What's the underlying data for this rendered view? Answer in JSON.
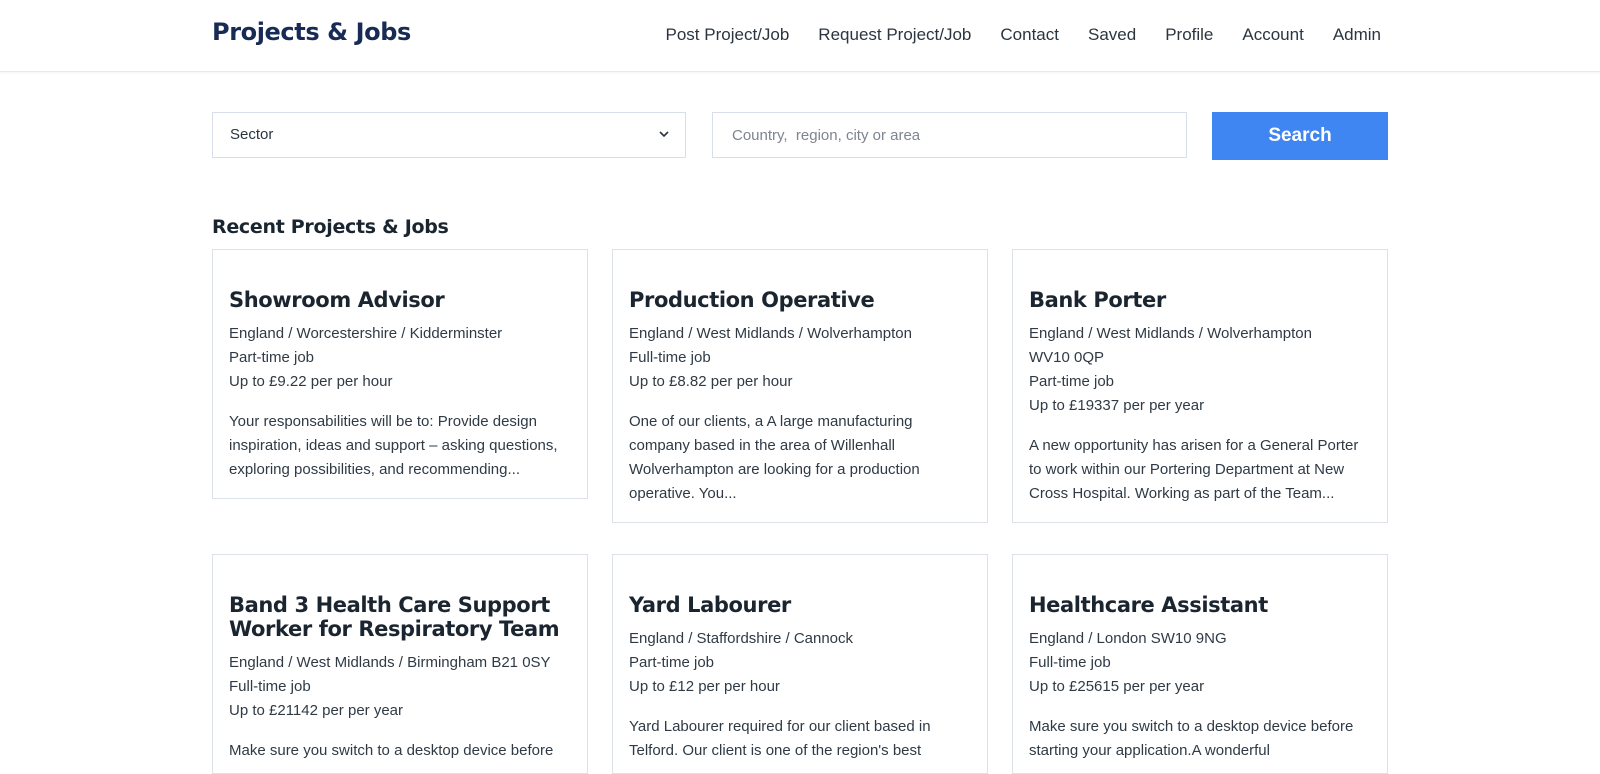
{
  "header": {
    "logo": "Projects & Jobs",
    "nav": [
      "Post Project/Job",
      "Request Project/Job",
      "Contact",
      "Saved",
      "Profile",
      "Account",
      "Admin"
    ]
  },
  "search": {
    "sector_value": "Sector",
    "location_placeholder": "Country,  region, city or area",
    "button_label": "Search"
  },
  "section_title": "Recent Projects & Jobs",
  "jobs": [
    {
      "title": "Showroom Advisor",
      "location": "England / Worcestershire / Kidderminster",
      "type": "Part-time job",
      "pay": "Up to £9.22 per per hour",
      "description": "Your responsabilities will be to: Provide design inspiration, ideas and support – asking questions, exploring possibilities, and recommending..."
    },
    {
      "title": "Production Operative",
      "location": "England / West Midlands / Wolverhampton",
      "type": "Full-time job",
      "pay": "Up to £8.82 per per hour",
      "description": "One of our clients, a A large manufacturing company based in the area of Willenhall Wolverhampton are looking for a production operative. You..."
    },
    {
      "title": "Bank Porter",
      "location": "England / West Midlands / Wolverhampton",
      "postcode": "WV10 0QP",
      "type": "Part-time job",
      "pay": "Up to £19337 per per year",
      "description": "A new  opportunity has arisen for a General Porter to work within our Portering Department at New Cross Hospital. Working as part of the Team..."
    },
    {
      "title": "Band 3 Health Care Support Worker for Respiratory Team",
      "location": "England / West Midlands / Birmingham   B21 0SY",
      "type": "Full-time job",
      "pay": "Up to £21142 per per year",
      "description": "Make sure you switch to a desktop device before"
    },
    {
      "title": "Yard Labourer",
      "location": "England / Staffordshire / Cannock",
      "type": "Part-time job",
      "pay": "Up to £12 per per hour",
      "description": "Yard Labourer required for our client based in Telford. Our client is one of the region's best"
    },
    {
      "title": "Healthcare Assistant",
      "location": "England / London   SW10 9NG",
      "type": "Full-time job",
      "pay": "Up to £25615 per per year",
      "description": "Make sure you  switch to a desktop device before starting your application.A wonderful"
    }
  ],
  "colors": {
    "brand": "#172b55",
    "accent": "#3f86f3",
    "border": "#dde2ea"
  },
  "icons": {
    "sector_dropdown": "chevron-down-icon"
  }
}
